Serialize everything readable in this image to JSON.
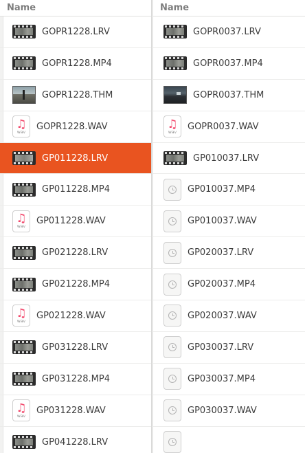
{
  "left_pane": {
    "header": "Name",
    "files": [
      {
        "name": "GOPR1228.LRV",
        "icon": "video-file-icon",
        "selected": false
      },
      {
        "name": "GOPR1228.MP4",
        "icon": "video-file-icon",
        "selected": false
      },
      {
        "name": "GOPR1228.THM",
        "icon": "image-thumbnail-icon",
        "selected": false
      },
      {
        "name": "GOPR1228.WAV",
        "icon": "audio-file-icon",
        "selected": false
      },
      {
        "name": "GP011228.LRV",
        "icon": "video-file-icon",
        "selected": true
      },
      {
        "name": "GP011228.MP4",
        "icon": "video-file-icon",
        "selected": false
      },
      {
        "name": "GP011228.WAV",
        "icon": "audio-file-icon",
        "selected": false
      },
      {
        "name": "GP021228.LRV",
        "icon": "video-file-icon",
        "selected": false
      },
      {
        "name": "GP021228.MP4",
        "icon": "video-file-icon",
        "selected": false
      },
      {
        "name": "GP021228.WAV",
        "icon": "audio-file-icon",
        "selected": false
      },
      {
        "name": "GP031228.LRV",
        "icon": "video-file-icon",
        "selected": false
      },
      {
        "name": "GP031228.MP4",
        "icon": "video-file-icon",
        "selected": false
      },
      {
        "name": "GP031228.WAV",
        "icon": "audio-file-icon",
        "selected": false
      },
      {
        "name": "GP041228.LRV",
        "icon": "video-file-icon",
        "selected": false
      }
    ]
  },
  "right_pane": {
    "header": "Name",
    "files": [
      {
        "name": "GOPR0037.LRV",
        "icon": "video-file-icon"
      },
      {
        "name": "GOPR0037.MP4",
        "icon": "video-file-icon"
      },
      {
        "name": "GOPR0037.THM",
        "icon": "image-thumbnail-icon"
      },
      {
        "name": "GOPR0037.WAV",
        "icon": "audio-file-icon"
      },
      {
        "name": "GP010037.LRV",
        "icon": "video-file-icon"
      },
      {
        "name": "GP010037.MP4",
        "icon": "pending-clock-icon"
      },
      {
        "name": "GP010037.WAV",
        "icon": "pending-clock-icon"
      },
      {
        "name": "GP020037.LRV",
        "icon": "pending-clock-icon"
      },
      {
        "name": "GP020037.MP4",
        "icon": "pending-clock-icon"
      },
      {
        "name": "GP020037.WAV",
        "icon": "pending-clock-icon"
      },
      {
        "name": "GP030037.LRV",
        "icon": "pending-clock-icon"
      },
      {
        "name": "GP030037.MP4",
        "icon": "pending-clock-icon"
      },
      {
        "name": "GP030037.WAV",
        "icon": "pending-clock-icon"
      }
    ]
  },
  "audio_icon_label": "wav",
  "colors": {
    "selection": "#e95420",
    "audio_note": "#f2476b"
  }
}
